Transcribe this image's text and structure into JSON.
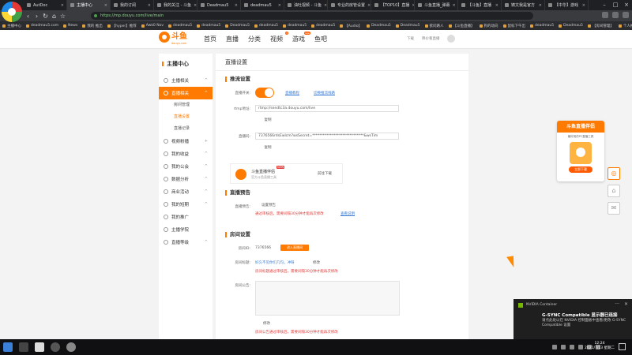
{
  "browser": {
    "tabs": [
      {
        "label": "AutDoc",
        "active": false
      },
      {
        "label": "主播中心",
        "active": true
      },
      {
        "label": "我的订阅",
        "active": false
      },
      {
        "label": "我的关注 - 斗鱼",
        "active": false
      },
      {
        "label": "Deadmau5",
        "active": false
      },
      {
        "label": "deadmau5",
        "active": false
      },
      {
        "label": "油吐视频 - 斗鱼",
        "active": false
      },
      {
        "label": "专业的房管设置",
        "active": false
      },
      {
        "label": "【TOP10】直播",
        "active": false
      },
      {
        "label": "斗鱼直播_弹幕",
        "active": false
      },
      {
        "label": "【斗鱼】直播",
        "active": false
      },
      {
        "label": "铸文我是官方",
        "active": false
      },
      {
        "label": "【中华】游戏",
        "active": false
      }
    ],
    "url": "https://mp.douyu.com/live/main",
    "bookmarks": [
      "主播中心",
      "deadmau5.com",
      "News",
      "我的 推出",
      "【hyper】推荐",
      "Awk0 Nov",
      "deadmau5",
      "deadmau5",
      "Deadmau5",
      "deadmau5",
      "deadmau5",
      "deadmau5",
      "【Audio】",
      "Deadmau5",
      "Deadmau5",
      "欲问路人",
      "【斗鱼直播】",
      "狗的动向",
      "鼠标下午出",
      "deadmau5",
      "Deadmau5",
      "【房间管理】",
      "个人推荐",
      "推荐详细"
    ]
  },
  "site": {
    "logo_text": "斗鱼",
    "logo_sub": "douyu.com",
    "nav": [
      {
        "label": "首页",
        "badge": ""
      },
      {
        "label": "直播",
        "badge": ""
      },
      {
        "label": "分类",
        "badge": ""
      },
      {
        "label": "视频",
        "badge": "4"
      },
      {
        "label": "游戏",
        "badge": "new"
      },
      {
        "label": "鱼吧",
        "badge": ""
      }
    ],
    "header_right": [
      "下载",
      "降价看直播"
    ]
  },
  "sidebar": {
    "title": "主播中心",
    "items": [
      {
        "label": "主播相关",
        "active": false,
        "chev": "^"
      },
      {
        "label": "直播相关",
        "active": true,
        "chev": "^"
      },
      {
        "label": "视频粉播",
        "active": false,
        "chev": "+"
      },
      {
        "label": "我的收益",
        "active": false,
        "chev": "^"
      },
      {
        "label": "我的公会",
        "active": false,
        "chev": "^"
      },
      {
        "label": "数据分析",
        "active": false,
        "chev": "^"
      },
      {
        "label": "商业活动",
        "active": false,
        "chev": "^"
      },
      {
        "label": "我的短期",
        "active": false,
        "chev": "^"
      },
      {
        "label": "我的推广",
        "active": false,
        "chev": ""
      },
      {
        "label": "主播学院",
        "active": false,
        "chev": ""
      },
      {
        "label": "直播等级",
        "active": false,
        "chev": "^"
      }
    ],
    "subitems": [
      {
        "label": "房间管理",
        "current": false
      },
      {
        "label": "直播设置",
        "current": true
      },
      {
        "label": "直播记录",
        "current": false
      }
    ]
  },
  "main": {
    "page_title": "直播设置",
    "push": {
      "heading": "推流设置",
      "toggle_label": "直播开关:",
      "tutorial_link": "直播教程",
      "switch_link": "切换推流线路",
      "rtmp_label": "rtmp地址:",
      "rtmp_value": "rtmp://sendtc3a.douyu.com/live",
      "copy1": "复制",
      "key_label": "直播码:",
      "key_value": "7376566rdsEwlcm?wsSecret=*****************************&wsTim",
      "copy2": "复制",
      "helper_name": "斗鱼直播伴侣",
      "helper_new": "NEW",
      "helper_desc": "官方斗鱼直播工具",
      "helper_download": "前往下载"
    },
    "notice": {
      "heading": "直播预告",
      "label": "直播预告:",
      "button": "设置预告",
      "warn": "通过审核后，需要间隔30分钟才能再次修改",
      "link": "查看说明"
    },
    "room": {
      "heading": "房间设置",
      "id_label": "房间ID:",
      "id_value": "7376566",
      "enter_button": "进入直播间",
      "title_label": "房间标题:",
      "title_value": "好久不见你们几句，冲呀",
      "title_edit": "修改",
      "title_warn": "房间标题通过审核后，需要间隔30分钟才能再次修改",
      "notice_label": "房间公告:",
      "notice_edit": "修改",
      "notice_warn": "房间公告通过审核后，需要间隔30分钟才能再次修改"
    }
  },
  "float_card": {
    "title": "斗鱼直播伴侣",
    "desc": "最好用的PC直播工具",
    "download": "立即下载"
  },
  "toast": {
    "app": "NVIDIA Container",
    "title": "G-SYNC Compatible 显示器已连接",
    "body": "请点此处以在 NVIDIA 控制面板中查看/更改 G-SYNC Compatible 设置"
  },
  "clock": {
    "time": "12:24",
    "date": "2021/7/13 星期二"
  },
  "colors": {
    "accent": "#ff7a00",
    "link": "#3a7bd5",
    "warn": "#e53935"
  }
}
